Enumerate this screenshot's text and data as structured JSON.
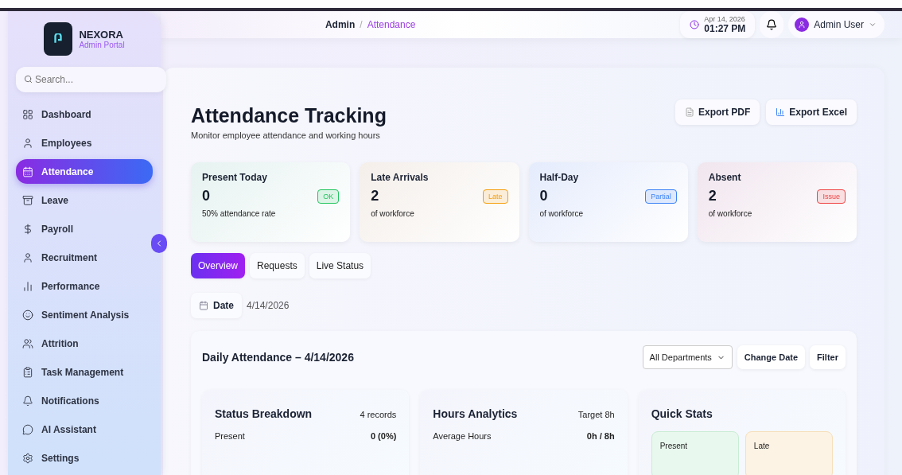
{
  "brand": {
    "name": "NEXORA",
    "subtitle": "Admin Portal"
  },
  "search": {
    "placeholder": "Search..."
  },
  "sidebar": {
    "items": [
      {
        "label": "Dashboard",
        "selected": false
      },
      {
        "label": "Employees",
        "selected": false
      },
      {
        "label": "Attendance",
        "selected": true
      },
      {
        "label": "Leave",
        "selected": false
      },
      {
        "label": "Payroll",
        "selected": false
      },
      {
        "label": "Recruitment",
        "selected": false
      },
      {
        "label": "Performance",
        "selected": false
      },
      {
        "label": "Sentiment Analysis",
        "selected": false
      },
      {
        "label": "Attrition",
        "selected": false
      },
      {
        "label": "Task Management",
        "selected": false
      },
      {
        "label": "Notifications",
        "selected": false
      },
      {
        "label": "AI Assistant",
        "selected": false
      },
      {
        "label": "Settings",
        "selected": false
      }
    ]
  },
  "header": {
    "breadcrumb": {
      "items": [
        "Admin",
        "Attendance"
      ],
      "separator": "/"
    },
    "date": "Apr 14, 2026",
    "time": "01:27 PM",
    "user": "Admin User"
  },
  "page": {
    "title": "Attendance Tracking",
    "subtitle": "Monitor employee attendance and working hours",
    "actions": [
      "Export PDF",
      "Export Excel"
    ]
  },
  "stats": [
    {
      "title": "Present Today",
      "value": "0",
      "badge": "OK",
      "note": "50% attendance rate",
      "color": "#22c55e"
    },
    {
      "title": "Late Arrivals",
      "value": "2",
      "badge": "Late",
      "note": "of workforce",
      "color": "#f59e0b"
    },
    {
      "title": "Half-Day",
      "value": "0",
      "badge": "Partial",
      "note": "of workforce",
      "color": "#3b82f6"
    },
    {
      "title": "Absent",
      "value": "2",
      "badge": "Issue",
      "note": "of workforce",
      "color": "#ef4444"
    }
  ],
  "tabs": [
    {
      "label": "Overview",
      "selected": true
    },
    {
      "label": "Requests",
      "selected": false
    },
    {
      "label": "Live Status",
      "selected": false
    }
  ],
  "date_filter": {
    "label": "Date",
    "value": "4/14/2026"
  },
  "daily": {
    "title": "Daily Attendance – 4/14/2026",
    "department": "All Departments",
    "buttons": [
      "Change Date",
      "Filter"
    ],
    "panels": [
      {
        "title": "Status Breakdown",
        "meta": "4 records",
        "row_label": "Present",
        "row_value": "0 (0%)"
      },
      {
        "title": "Hours Analytics",
        "meta": "Target 8h",
        "row_label": "Average Hours",
        "row_value": "0h / 8h"
      }
    ],
    "quick_stats": {
      "title": "Quick Stats",
      "items": [
        "Present",
        "Late"
      ]
    }
  }
}
